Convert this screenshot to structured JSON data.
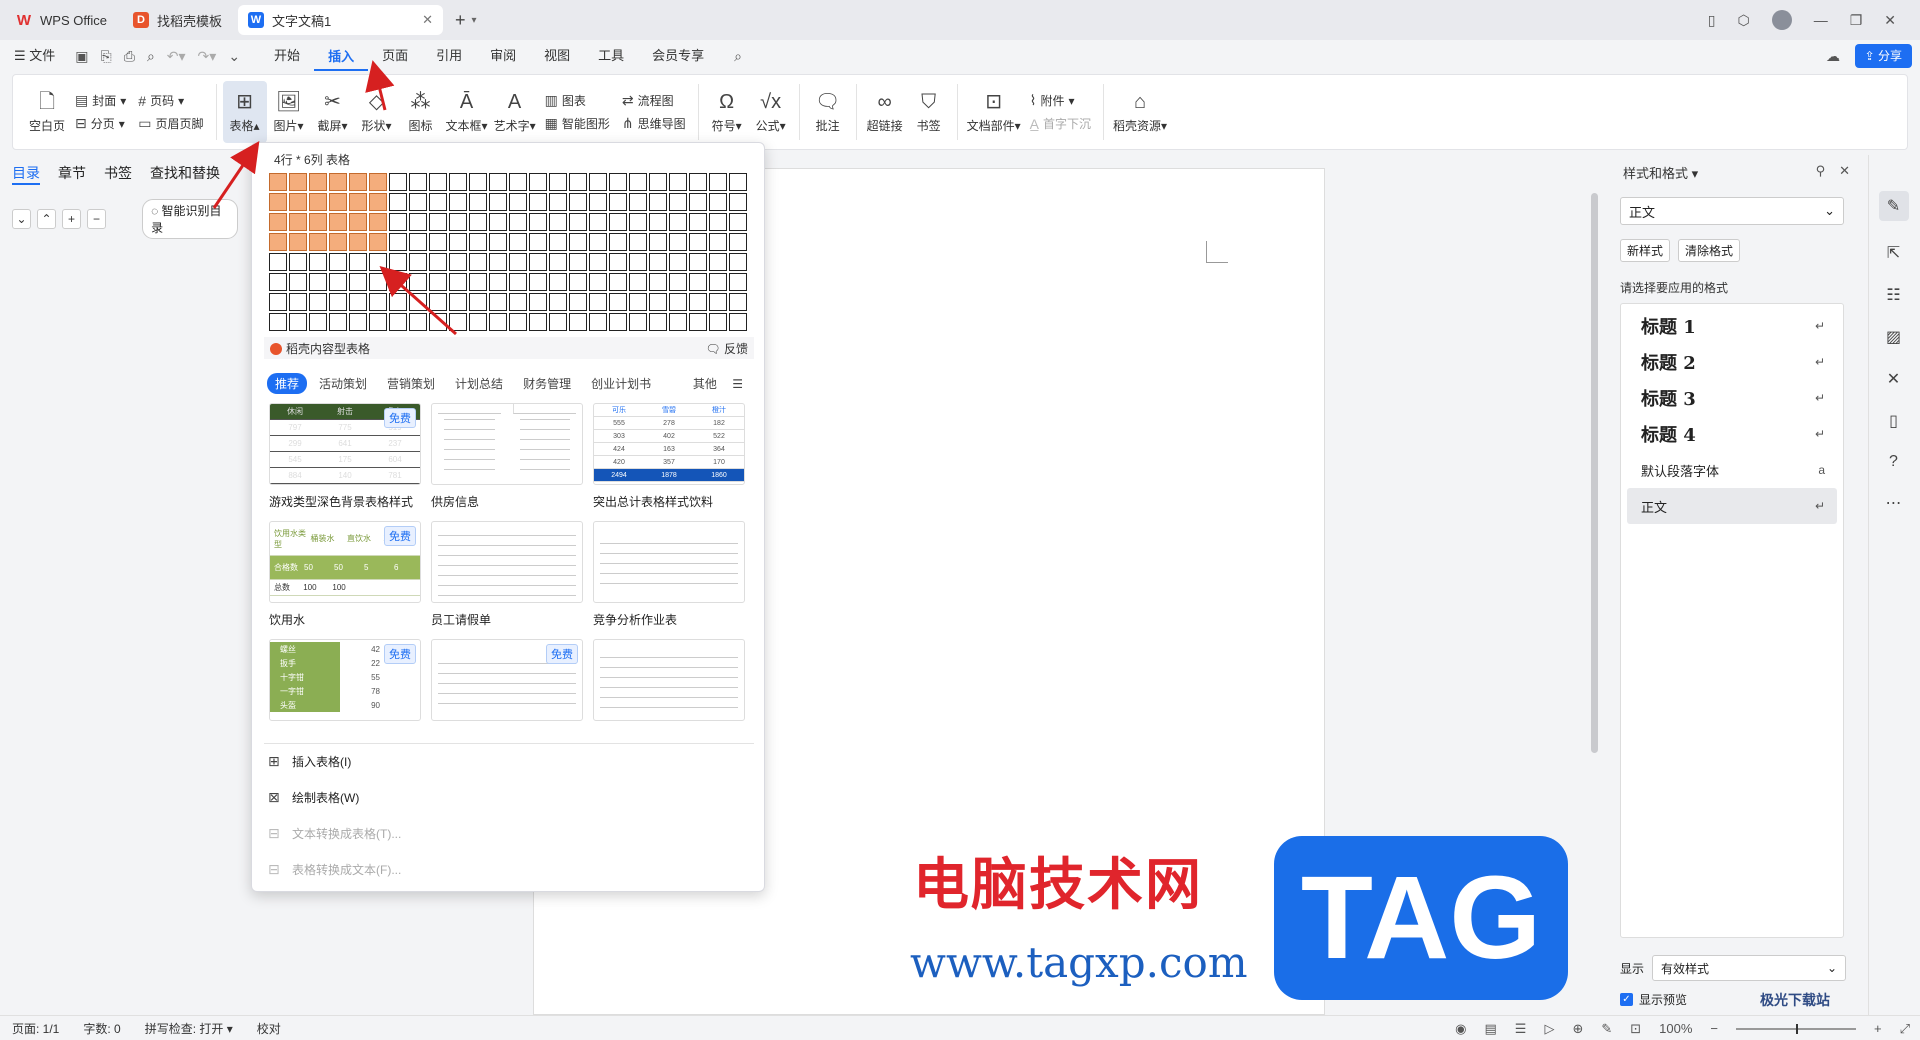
{
  "titlebar": {
    "tabs": [
      {
        "label": "WPS Office"
      },
      {
        "label": "找稻壳模板"
      },
      {
        "label": "文字文稿1"
      }
    ]
  },
  "menubar": {
    "file": "文件",
    "items": [
      "开始",
      "插入",
      "页面",
      "引用",
      "审阅",
      "视图",
      "工具",
      "会员专享"
    ],
    "share": "分享"
  },
  "ribbon": {
    "cover": "封面",
    "page_num": "页码",
    "blank_page": "空白页",
    "page_break": "分页",
    "header_footer": "页眉页脚",
    "table": "表格",
    "picture": "图片",
    "screenshot": "截屏",
    "shape": "形状",
    "icon": "图标",
    "textbox": "文本框",
    "wordart": "艺术字",
    "chart": "图表",
    "smartart": "智能图形",
    "flowchart": "流程图",
    "mindmap": "思维导图",
    "symbol": "符号",
    "formula": "公式",
    "comment": "批注",
    "hyperlink": "超链接",
    "bookmark": "书签",
    "doc_parts": "文档部件",
    "attachment": "附件",
    "dropcap": "首字下沉",
    "docer": "稻壳资源"
  },
  "left_pane": {
    "tabs": [
      "目录",
      "章节",
      "书签",
      "查找和替换"
    ],
    "smart_btn": "智能识别目录"
  },
  "table_dropdown": {
    "grid_label": "4行 * 6列 表格",
    "grid_rows": 8,
    "grid_cols": 24,
    "selected_rows": 4,
    "selected_cols": 6,
    "ai_table": "稻壳内容型表格",
    "feedback": "反馈",
    "categories": [
      "推荐",
      "活动策划",
      "营销策划",
      "计划总结",
      "财务管理",
      "创业计划书"
    ],
    "more": "其他",
    "templates": [
      {
        "name": "游戏类型深色背景表格样式",
        "free": "免费"
      },
      {
        "name": "供房信息",
        "free": ""
      },
      {
        "name": "突出总计表格样式饮料",
        "free": ""
      },
      {
        "name": "饮用水",
        "free": "免费"
      },
      {
        "name": "员工请假单",
        "free": ""
      },
      {
        "name": "竞争分析作业表",
        "free": ""
      },
      {
        "name": "",
        "free": "免费"
      },
      {
        "name": "",
        "free": "免费"
      },
      {
        "name": "",
        "free": ""
      }
    ],
    "thumb_dark": {
      "header": [
        "休闲",
        "射击",
        "角色"
      ],
      "rows": [
        [
          "797",
          "775",
          "519"
        ],
        [
          "299",
          "641",
          "237"
        ],
        [
          "545",
          "175",
          "604"
        ],
        [
          "884",
          "140",
          "781"
        ]
      ]
    },
    "thumb_blue": {
      "header": [
        "可乐",
        "雪碧",
        "橙汁"
      ],
      "rows": [
        [
          "555",
          "278",
          "182"
        ],
        [
          "303",
          "402",
          "522"
        ],
        [
          "424",
          "163",
          "364"
        ],
        [
          "420",
          "357",
          "170"
        ]
      ],
      "total": [
        "2494",
        "1878",
        "1860"
      ]
    },
    "thumb_water": {
      "header": [
        "饮用水类型",
        "桶装水",
        "直饮水",
        "X"
      ],
      "rows": [
        [
          "合格数",
          "50",
          "50",
          "5",
          "6"
        ],
        [
          "总数",
          "100",
          "100",
          "",
          ""
        ]
      ]
    },
    "thumb_tools": {
      "rows": [
        [
          "螺丝",
          "42"
        ],
        [
          "扳手",
          "22"
        ],
        [
          "十字钳",
          "55"
        ],
        [
          "一字钳",
          "78"
        ],
        [
          "头盔",
          "90"
        ]
      ]
    },
    "insert_table": "插入表格(I)",
    "draw_table": "绘制表格(W)",
    "text_to_table": "文本转换成表格(T)...",
    "table_to_text": "表格转换成文本(F)..."
  },
  "right_pane": {
    "title": "样式和格式",
    "current_style": "正文",
    "new_style": "新样式",
    "clear_format": "清除格式",
    "apply_label": "请选择要应用的格式",
    "styles": [
      {
        "label": "标题  1",
        "mark": "↵"
      },
      {
        "label": "标题  2",
        "mark": "↵"
      },
      {
        "label": "标题  3",
        "mark": "↵"
      },
      {
        "label": "标题  4",
        "mark": "↵"
      },
      {
        "label": "默认段落字体",
        "mark": "a"
      },
      {
        "label": "正文",
        "mark": "↵"
      }
    ],
    "show_label": "显示",
    "show_value": "有效样式",
    "preview": "显示预览"
  },
  "statusbar": {
    "page": "页面: 1/1",
    "words": "字数: 0",
    "spellcheck": "拼写检查: 打开",
    "proof": "校对",
    "zoom": "100%"
  },
  "watermark": {
    "cn": "电脑技术网",
    "url": "www.tagxp.com",
    "tag": "TAG",
    "corner": "极光下载站"
  },
  "colors": {
    "accent": "#1d6ef2",
    "grid_selected": "#f4ad7c",
    "arrow": "#d62020"
  }
}
